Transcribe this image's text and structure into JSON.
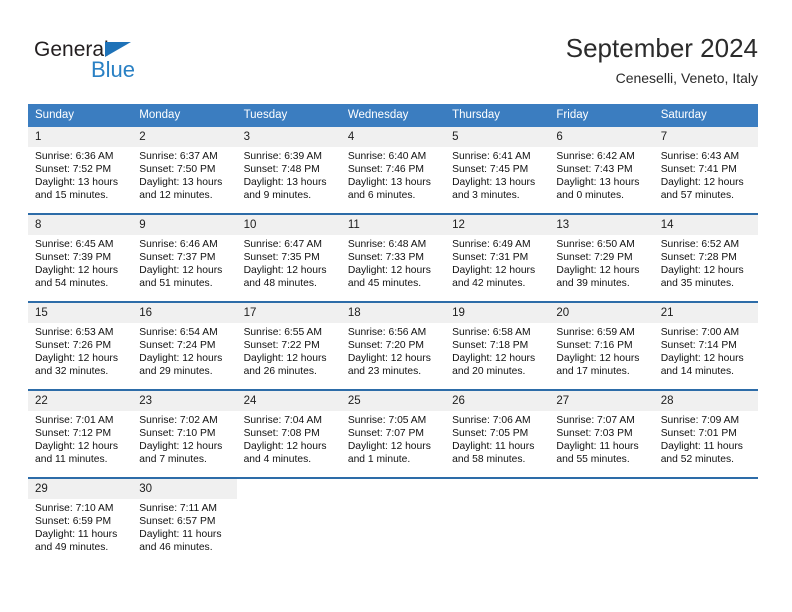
{
  "brand": {
    "name_dark": "General",
    "name_blue": "Blue",
    "triangle_color": "#1e72b8",
    "blue_color": "#2980c4"
  },
  "header": {
    "month_title": "September 2024",
    "location": "Ceneselli, Veneto, Italy"
  },
  "theme": {
    "header_blue": "#3b7dc0",
    "row_divider": "#2d6ca8",
    "daynum_band": "#f0f0f0"
  },
  "calendar": {
    "weekday_headers": [
      "Sunday",
      "Monday",
      "Tuesday",
      "Wednesday",
      "Thursday",
      "Friday",
      "Saturday"
    ],
    "weeks": [
      [
        {
          "day": "1",
          "sunrise": "Sunrise: 6:36 AM",
          "sunset": "Sunset: 7:52 PM",
          "daylight_line1": "Daylight: 13 hours",
          "daylight_line2": "and 15 minutes."
        },
        {
          "day": "2",
          "sunrise": "Sunrise: 6:37 AM",
          "sunset": "Sunset: 7:50 PM",
          "daylight_line1": "Daylight: 13 hours",
          "daylight_line2": "and 12 minutes."
        },
        {
          "day": "3",
          "sunrise": "Sunrise: 6:39 AM",
          "sunset": "Sunset: 7:48 PM",
          "daylight_line1": "Daylight: 13 hours",
          "daylight_line2": "and 9 minutes."
        },
        {
          "day": "4",
          "sunrise": "Sunrise: 6:40 AM",
          "sunset": "Sunset: 7:46 PM",
          "daylight_line1": "Daylight: 13 hours",
          "daylight_line2": "and 6 minutes."
        },
        {
          "day": "5",
          "sunrise": "Sunrise: 6:41 AM",
          "sunset": "Sunset: 7:45 PM",
          "daylight_line1": "Daylight: 13 hours",
          "daylight_line2": "and 3 minutes."
        },
        {
          "day": "6",
          "sunrise": "Sunrise: 6:42 AM",
          "sunset": "Sunset: 7:43 PM",
          "daylight_line1": "Daylight: 13 hours",
          "daylight_line2": "and 0 minutes."
        },
        {
          "day": "7",
          "sunrise": "Sunrise: 6:43 AM",
          "sunset": "Sunset: 7:41 PM",
          "daylight_line1": "Daylight: 12 hours",
          "daylight_line2": "and 57 minutes."
        }
      ],
      [
        {
          "day": "8",
          "sunrise": "Sunrise: 6:45 AM",
          "sunset": "Sunset: 7:39 PM",
          "daylight_line1": "Daylight: 12 hours",
          "daylight_line2": "and 54 minutes."
        },
        {
          "day": "9",
          "sunrise": "Sunrise: 6:46 AM",
          "sunset": "Sunset: 7:37 PM",
          "daylight_line1": "Daylight: 12 hours",
          "daylight_line2": "and 51 minutes."
        },
        {
          "day": "10",
          "sunrise": "Sunrise: 6:47 AM",
          "sunset": "Sunset: 7:35 PM",
          "daylight_line1": "Daylight: 12 hours",
          "daylight_line2": "and 48 minutes."
        },
        {
          "day": "11",
          "sunrise": "Sunrise: 6:48 AM",
          "sunset": "Sunset: 7:33 PM",
          "daylight_line1": "Daylight: 12 hours",
          "daylight_line2": "and 45 minutes."
        },
        {
          "day": "12",
          "sunrise": "Sunrise: 6:49 AM",
          "sunset": "Sunset: 7:31 PM",
          "daylight_line1": "Daylight: 12 hours",
          "daylight_line2": "and 42 minutes."
        },
        {
          "day": "13",
          "sunrise": "Sunrise: 6:50 AM",
          "sunset": "Sunset: 7:29 PM",
          "daylight_line1": "Daylight: 12 hours",
          "daylight_line2": "and 39 minutes."
        },
        {
          "day": "14",
          "sunrise": "Sunrise: 6:52 AM",
          "sunset": "Sunset: 7:28 PM",
          "daylight_line1": "Daylight: 12 hours",
          "daylight_line2": "and 35 minutes."
        }
      ],
      [
        {
          "day": "15",
          "sunrise": "Sunrise: 6:53 AM",
          "sunset": "Sunset: 7:26 PM",
          "daylight_line1": "Daylight: 12 hours",
          "daylight_line2": "and 32 minutes."
        },
        {
          "day": "16",
          "sunrise": "Sunrise: 6:54 AM",
          "sunset": "Sunset: 7:24 PM",
          "daylight_line1": "Daylight: 12 hours",
          "daylight_line2": "and 29 minutes."
        },
        {
          "day": "17",
          "sunrise": "Sunrise: 6:55 AM",
          "sunset": "Sunset: 7:22 PM",
          "daylight_line1": "Daylight: 12 hours",
          "daylight_line2": "and 26 minutes."
        },
        {
          "day": "18",
          "sunrise": "Sunrise: 6:56 AM",
          "sunset": "Sunset: 7:20 PM",
          "daylight_line1": "Daylight: 12 hours",
          "daylight_line2": "and 23 minutes."
        },
        {
          "day": "19",
          "sunrise": "Sunrise: 6:58 AM",
          "sunset": "Sunset: 7:18 PM",
          "daylight_line1": "Daylight: 12 hours",
          "daylight_line2": "and 20 minutes."
        },
        {
          "day": "20",
          "sunrise": "Sunrise: 6:59 AM",
          "sunset": "Sunset: 7:16 PM",
          "daylight_line1": "Daylight: 12 hours",
          "daylight_line2": "and 17 minutes."
        },
        {
          "day": "21",
          "sunrise": "Sunrise: 7:00 AM",
          "sunset": "Sunset: 7:14 PM",
          "daylight_line1": "Daylight: 12 hours",
          "daylight_line2": "and 14 minutes."
        }
      ],
      [
        {
          "day": "22",
          "sunrise": "Sunrise: 7:01 AM",
          "sunset": "Sunset: 7:12 PM",
          "daylight_line1": "Daylight: 12 hours",
          "daylight_line2": "and 11 minutes."
        },
        {
          "day": "23",
          "sunrise": "Sunrise: 7:02 AM",
          "sunset": "Sunset: 7:10 PM",
          "daylight_line1": "Daylight: 12 hours",
          "daylight_line2": "and 7 minutes."
        },
        {
          "day": "24",
          "sunrise": "Sunrise: 7:04 AM",
          "sunset": "Sunset: 7:08 PM",
          "daylight_line1": "Daylight: 12 hours",
          "daylight_line2": "and 4 minutes."
        },
        {
          "day": "25",
          "sunrise": "Sunrise: 7:05 AM",
          "sunset": "Sunset: 7:07 PM",
          "daylight_line1": "Daylight: 12 hours",
          "daylight_line2": "and 1 minute."
        },
        {
          "day": "26",
          "sunrise": "Sunrise: 7:06 AM",
          "sunset": "Sunset: 7:05 PM",
          "daylight_line1": "Daylight: 11 hours",
          "daylight_line2": "and 58 minutes."
        },
        {
          "day": "27",
          "sunrise": "Sunrise: 7:07 AM",
          "sunset": "Sunset: 7:03 PM",
          "daylight_line1": "Daylight: 11 hours",
          "daylight_line2": "and 55 minutes."
        },
        {
          "day": "28",
          "sunrise": "Sunrise: 7:09 AM",
          "sunset": "Sunset: 7:01 PM",
          "daylight_line1": "Daylight: 11 hours",
          "daylight_line2": "and 52 minutes."
        }
      ],
      [
        {
          "day": "29",
          "sunrise": "Sunrise: 7:10 AM",
          "sunset": "Sunset: 6:59 PM",
          "daylight_line1": "Daylight: 11 hours",
          "daylight_line2": "and 49 minutes."
        },
        {
          "day": "30",
          "sunrise": "Sunrise: 7:11 AM",
          "sunset": "Sunset: 6:57 PM",
          "daylight_line1": "Daylight: 11 hours",
          "daylight_line2": "and 46 minutes."
        },
        {
          "day": "",
          "sunrise": "",
          "sunset": "",
          "daylight_line1": "",
          "daylight_line2": ""
        },
        {
          "day": "",
          "sunrise": "",
          "sunset": "",
          "daylight_line1": "",
          "daylight_line2": ""
        },
        {
          "day": "",
          "sunrise": "",
          "sunset": "",
          "daylight_line1": "",
          "daylight_line2": ""
        },
        {
          "day": "",
          "sunrise": "",
          "sunset": "",
          "daylight_line1": "",
          "daylight_line2": ""
        },
        {
          "day": "",
          "sunrise": "",
          "sunset": "",
          "daylight_line1": "",
          "daylight_line2": ""
        }
      ]
    ]
  }
}
